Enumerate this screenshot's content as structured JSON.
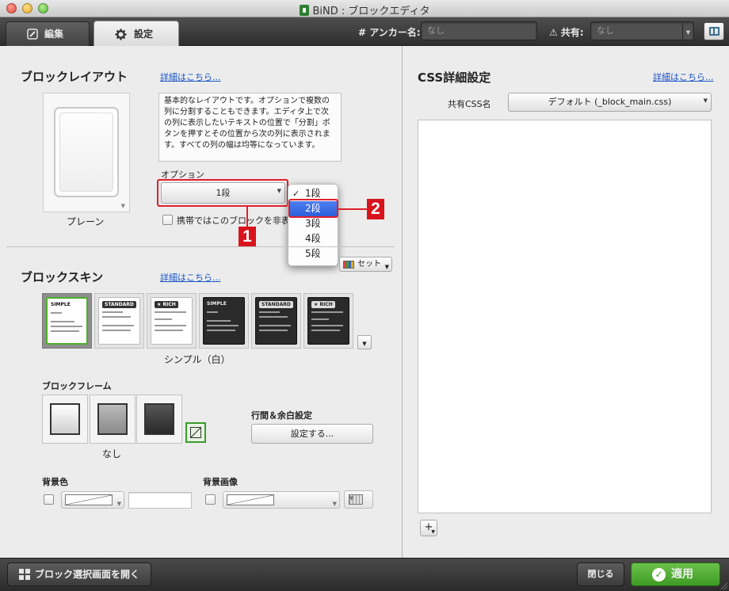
{
  "window": {
    "app_name": "BiND",
    "title": "BiND : ブロックエディタ"
  },
  "toolbar": {
    "tabs": [
      {
        "label": "編集",
        "icon": "pencil-icon",
        "active": false
      },
      {
        "label": "設定",
        "icon": "gear-icon",
        "active": true
      }
    ],
    "anchor_label": "# アンカー名:",
    "anchor_placeholder": "なし",
    "share_label": "共有:",
    "share_value": "なし"
  },
  "block_layout": {
    "heading": "ブロックレイアウト",
    "detail_link": "詳細はこちら...",
    "preview_caption": "プレーン",
    "description": "基本的なレイアウトです。オプションで複数の列に分割することもできます。エディタ上で次の列に表示したいテキストの位置で「分割」ボタンを押すとその位置から次の列に表示されます。すべての列の幅は均等になっています。",
    "option_label": "オプション",
    "option_value": "1段",
    "mobile_hide_label": "携帯ではこのブロックを非表示",
    "dropdown_items": [
      {
        "label": "1段",
        "checked": true,
        "highlighted": false
      },
      {
        "label": "2段",
        "checked": false,
        "highlighted": true
      },
      {
        "label": "3段",
        "checked": false,
        "highlighted": false
      },
      {
        "label": "4段",
        "checked": false,
        "highlighted": false
      },
      {
        "label": "5段",
        "checked": false,
        "highlighted": false
      }
    ]
  },
  "callouts": {
    "first": "1",
    "second": "2",
    "color": "#d7141c"
  },
  "block_skin": {
    "heading": "ブロックスキン",
    "detail_link": "詳細はこちら...",
    "set_label": "セット",
    "skins": [
      {
        "title": "SIMPLE",
        "theme": "light",
        "boxed": false,
        "selected": true
      },
      {
        "title": "STANDARD",
        "theme": "light",
        "boxed": true,
        "selected": false
      },
      {
        "title": "★ RICH",
        "theme": "light",
        "boxed": true,
        "selected": false
      },
      {
        "title": "SIMPLE",
        "theme": "dark",
        "boxed": false,
        "selected": false
      },
      {
        "title": "STANDARD",
        "theme": "dark",
        "boxed": true,
        "selected": false
      },
      {
        "title": "★ RICH",
        "theme": "dark",
        "boxed": true,
        "selected": false
      }
    ],
    "selected_name": "シンプル（白）"
  },
  "block_frame": {
    "label": "ブロックフレーム",
    "selected_name": "なし"
  },
  "spacing": {
    "label": "行間＆余白設定",
    "button_label": "設定する..."
  },
  "background": {
    "color_label": "背景色",
    "image_label": "背景画像"
  },
  "css_settings": {
    "heading": "CSS詳細設定",
    "detail_link": "詳細はこちら...",
    "shared_css_label": "共有CSS名",
    "shared_css_value": "デフォルト (_block_main.css)",
    "add_button": "+"
  },
  "footer": {
    "open_selector": "ブロック選択画面を開く",
    "close": "閉じる",
    "apply": "適用"
  },
  "colors": {
    "accent_blue": "#2c5fdc",
    "apply_green": "#3d9a25",
    "link_blue": "#1a55c8"
  }
}
